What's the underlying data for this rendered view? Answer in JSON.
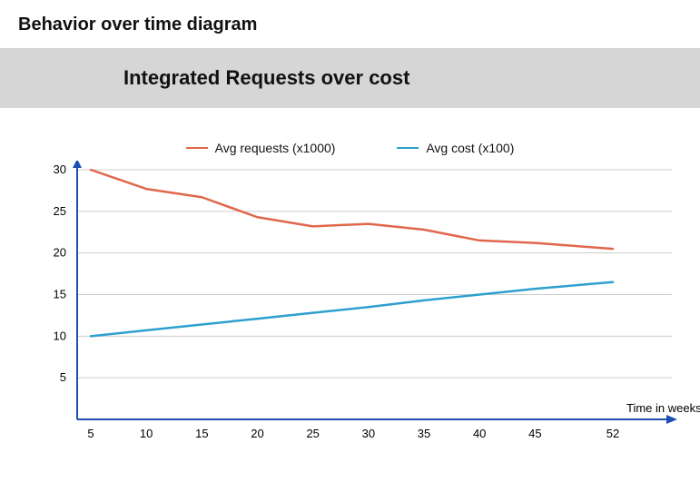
{
  "page_title": "Behavior over time diagram",
  "banner_title": "Integrated Requests over cost",
  "legend": {
    "series_a": "Avg requests (x1000)",
    "series_b": "Avg cost (x100)"
  },
  "xlabel": "Time in weeks",
  "colors": {
    "requests": "#e0674c",
    "cost": "#2ea0cf",
    "axis": "#1c4fb2",
    "grid": "#cccccc"
  },
  "chart_data": {
    "type": "line",
    "xlabel": "Time in weeks",
    "ylabel": "",
    "xlim": [
      5,
      52
    ],
    "ylim": [
      0,
      30
    ],
    "x_ticks": [
      5,
      10,
      15,
      20,
      25,
      30,
      35,
      40,
      45,
      52
    ],
    "y_ticks": [
      5,
      10,
      15,
      20,
      25,
      30
    ],
    "x": [
      5,
      10,
      15,
      20,
      25,
      30,
      35,
      40,
      45,
      52
    ],
    "series": [
      {
        "name": "Avg requests (x1000)",
        "color": "#e0674c",
        "values": [
          30.0,
          27.7,
          26.7,
          24.3,
          23.2,
          23.5,
          22.8,
          21.5,
          21.2,
          20.5
        ]
      },
      {
        "name": "Avg cost (x100)",
        "color": "#2ea0cf",
        "values": [
          10.0,
          10.7,
          11.4,
          12.1,
          12.8,
          13.5,
          14.3,
          15.0,
          15.7,
          16.5
        ]
      }
    ]
  }
}
